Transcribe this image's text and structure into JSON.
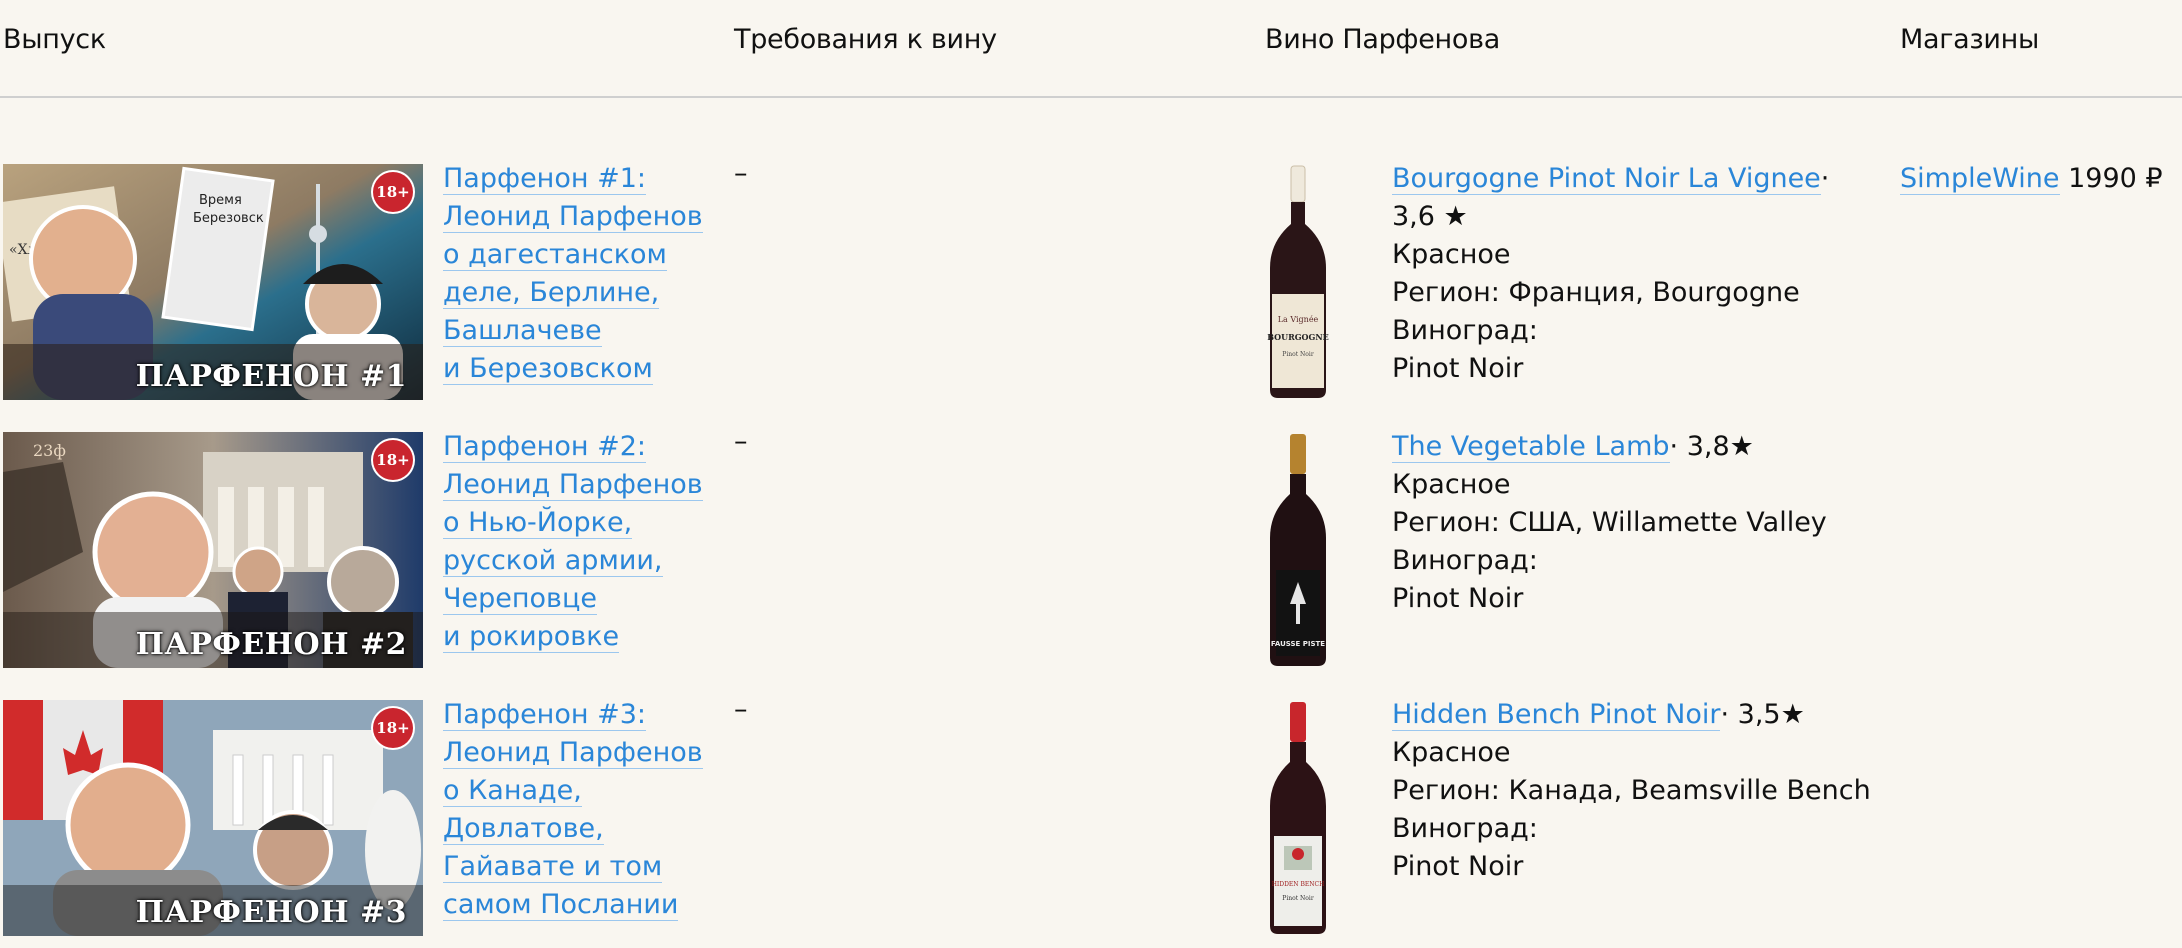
{
  "header": {
    "col_issue": "Выпуск",
    "col_requirements": "Требования к вину",
    "col_wine": "Вино Парфенова",
    "col_shops": "Магазины"
  },
  "rows": [
    {
      "thumb_title": "ПАРФЕНОН #1",
      "badge": "18+",
      "episode_lines": [
        "Парфенон #1:",
        "Леонид Парфенов",
        "о дагестанском",
        "деле, Берлине,",
        "Башлачеве",
        "и Березовском"
      ],
      "requirements": "–",
      "wine_name": "Bourgogne Pinot Noir La Vignee",
      "rating": "· 3,6 ★",
      "wine_color": "Красное",
      "region": "Регион: Франция, Bourgogne",
      "grape_label": "Виноград:",
      "grape": "Pinot Noir",
      "shop_name": "SimpleWine",
      "shop_price": "1990 ₽"
    },
    {
      "thumb_title": "ПАРФЕНОН #2",
      "badge": "18+",
      "episode_lines": [
        "Парфенон #2:",
        "Леонид Парфенов",
        "о Нью-Йорке,",
        "русской армии,",
        "Череповце",
        "и рокировке"
      ],
      "requirements": "–",
      "wine_name": "The Vegetable Lamb",
      "rating": "· 3,8★",
      "wine_color": "Красное",
      "region": "Регион: США, Willamette Valley",
      "grape_label": "Виноград:",
      "grape": "Pinot Noir",
      "shop_name": "",
      "shop_price": ""
    },
    {
      "thumb_title": "ПАРФЕНОН #3",
      "badge": "18+",
      "episode_lines": [
        "Парфенон #3:",
        "Леонид Парфенов",
        "о Канаде,",
        "Довлатове,",
        "Гайавате и том",
        "самом Послании"
      ],
      "requirements": "–",
      "wine_name": "Hidden Bench Pinot Noir",
      "rating": "· 3,5★",
      "wine_color": "Красное",
      "region": "Регион: Канада, Beamsville Bench",
      "grape_label": "Виноград:",
      "grape": "Pinot Noir",
      "shop_name": "",
      "shop_price": ""
    }
  ],
  "colors": {
    "background": "#f9f6f0",
    "link": "#2a86d8",
    "link_underline": "#9cc7ee",
    "badge": "#c9252e"
  }
}
